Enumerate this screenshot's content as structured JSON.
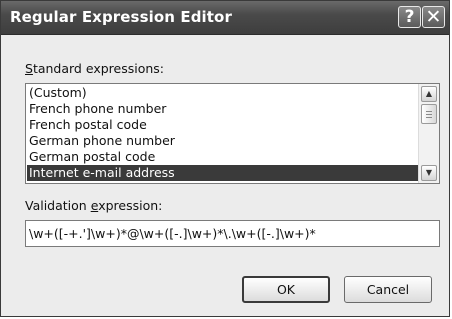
{
  "window": {
    "title": "Regular Expression Editor"
  },
  "titlebar": {
    "help_glyph": "?",
    "close_glyph": "✕"
  },
  "standard_expressions": {
    "label_accesskey": "S",
    "label_rest": "tandard expressions:",
    "items": [
      "(Custom)",
      "French phone number",
      "French postal code",
      "German phone number",
      "German postal code",
      "Internet e-mail address"
    ],
    "selected_item": "Internet e-mail address"
  },
  "validation": {
    "label_prefix": "Validation ",
    "label_accesskey": "e",
    "label_rest": "xpression:",
    "value": "\\w+([-+.']\\w+)*@\\w+([-.]\\w+)*\\.\\w+([-.]\\w+)*"
  },
  "buttons": {
    "ok_label": "OK",
    "cancel_label": "Cancel"
  }
}
